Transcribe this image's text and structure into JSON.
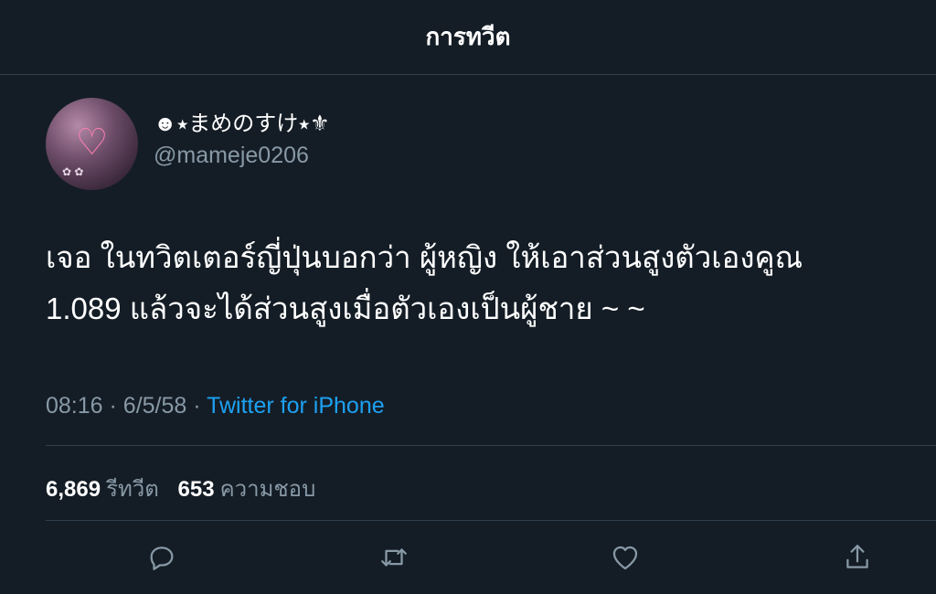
{
  "header": {
    "title": "การทวีต"
  },
  "user": {
    "display_name": "☻⭑まめのすけ⭑⚜",
    "handle": "@mameje0206"
  },
  "tweet": {
    "lines": [
      "เจอ ในทวิตเตอร์ญี่ปุ่นบอกว่า ผู้หญิง ให้เอาส่วนสูงตัวเองคูณ",
      "1.089 แล้วจะได้ส่วนสูงเมื่อตัวเองเป็นผู้ชาย ~ ~"
    ],
    "time": "08:16",
    "separator": "·",
    "date": "6/5/58",
    "source": "Twitter for iPhone"
  },
  "stats": {
    "retweets_count": "6,869",
    "retweets_label": "รีทวีต",
    "likes_count": "653",
    "likes_label": "ความชอบ"
  },
  "actions": [
    "reply-icon",
    "retweet-icon",
    "like-icon",
    "share-icon"
  ],
  "colors": {
    "background": "#141d26",
    "divider": "#2f3d4c",
    "muted": "#8899a6",
    "link": "#1da1f2"
  }
}
